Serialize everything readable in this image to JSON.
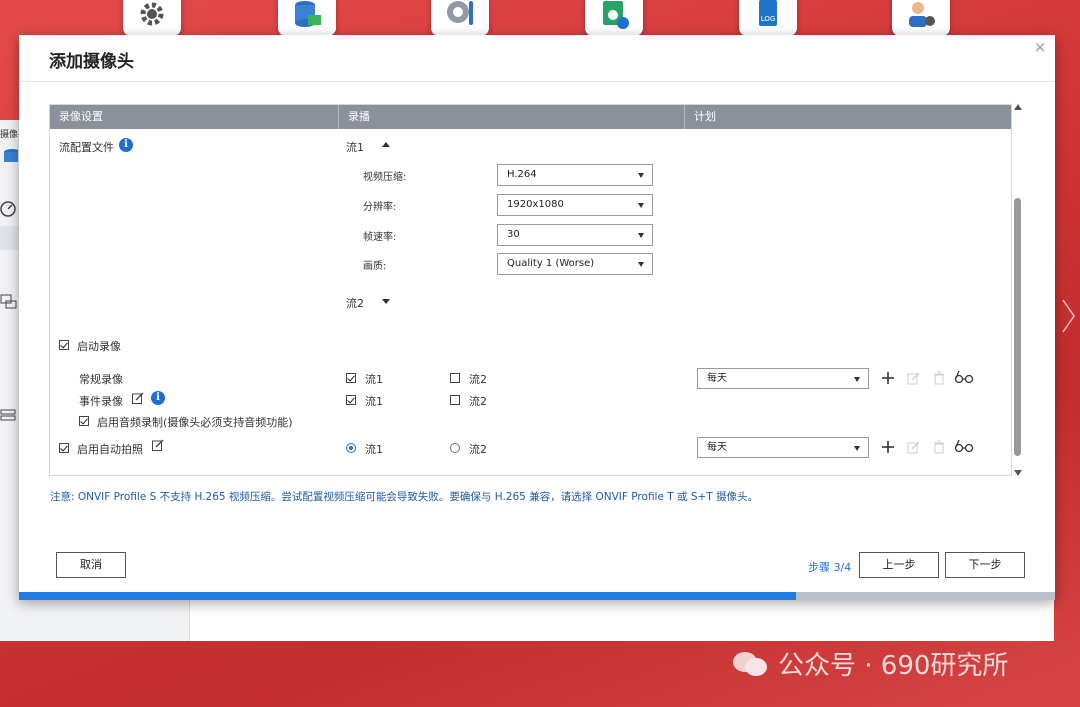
{
  "background": {
    "dock_icons": [
      "gear-icon",
      "storage-icon",
      "surveillance-icon",
      "app-center-icon",
      "log-icon",
      "user-settings-icon"
    ],
    "dock_log_text": "LOG",
    "sidebar_partial_label": "摄像存",
    "watermark": "公众号 · 690研究所"
  },
  "dialog": {
    "title": "添加摄像头",
    "close": "×",
    "table": {
      "headers": [
        "录像设置",
        "录播",
        "计划"
      ],
      "stream_profile_label": "流配置文件",
      "stream1_label": "流1",
      "stream2_label": "流2",
      "settings": [
        {
          "label": "视频压缩:",
          "value": "H.264"
        },
        {
          "label": "分辨率:",
          "value": "1920x1080"
        },
        {
          "label": "帧速率:",
          "value": "30"
        },
        {
          "label": "画质:",
          "value": "Quality 1 (Worse)"
        }
      ],
      "enable_recording": "启动录像",
      "regular_recording": "常规录像",
      "event_recording": "事件录像",
      "enable_audio": "启用音频录制(摄像头必须支持音频功能)",
      "enable_snapshot": "启用自动拍照",
      "stream1": "流1",
      "stream2": "流2",
      "schedule_regular": "每天",
      "schedule_snapshot": "每天",
      "info_glyph": "i"
    },
    "note": "注意: ONVIF Profile S 不支持 H.265 视频压缩。尝试配置视频压缩可能会导致失败。要确保与 H.265 兼容，请选择 ONVIF Profile T 或 S+T 摄像头。",
    "buttons": {
      "cancel": "取消",
      "step": "步骤 3/4",
      "prev": "上一步",
      "next": "下一步"
    },
    "progress": 0.75,
    "colors": {
      "header_bg": "#8a919a",
      "accent": "#1f6fd1",
      "progress": "#1f7ce0",
      "note": "#1f5aa8"
    }
  }
}
